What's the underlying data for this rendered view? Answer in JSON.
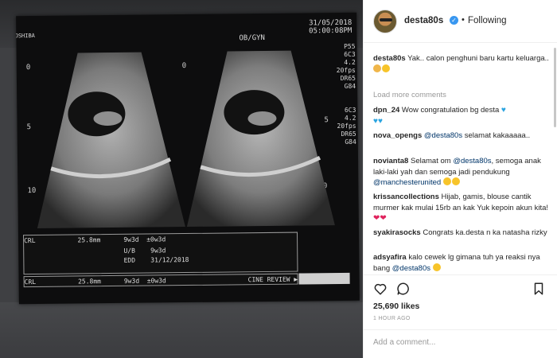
{
  "header": {
    "username": "desta80s",
    "verified_icon": "verified-badge-icon",
    "separator": "•",
    "follow_status": "Following"
  },
  "ultrasound": {
    "date": "31/05/2018",
    "time": "05:00:08PM",
    "mode": "OB/GYN",
    "brand": "TOSHIBA",
    "params_top": "P55\n6C3\n4.2\n20fps\nDR65\nG84",
    "params_mid": "6C3\n4.2\n20fps\nDR65\nG84",
    "scale_0": "0",
    "scale_5": "5",
    "scale_10": "10",
    "row1": "CRL           25.8mm      9w3d  ±0w3d",
    "row2": "                          U/B    9w3d",
    "row3": "                          EDD    31/12/2018",
    "row4": "CRL           25.8mm      9w3d  ±0w3d",
    "cine": "CINE REVIEW ▶"
  },
  "comments": {
    "caption": {
      "user": "desta80s",
      "text": "Yak.. calon penghuni baru kartu keluarga.."
    },
    "load_more": "Load more comments",
    "list": [
      {
        "user": "dpn_24",
        "text": "Wow congratulation bg desta"
      },
      {
        "user": "nova_opengs",
        "mention": "@desta80s",
        "text": "selamat kakaaaaa.."
      },
      {
        "user": "novianta8",
        "text_a": "Selamat om",
        "mention": "@desta80s",
        "text_b": ", semoga anak laki-laki yah dan semoga jadi pendukung",
        "mention2": "@manchesterunited"
      },
      {
        "user": "krissancollections",
        "text": "Hijab, gamis, blouse cantik murmer kak mulai 15rb an kak Yuk kepoin akun kita!"
      },
      {
        "user": "syakirasocks",
        "text": "Congrats ka.desta n ka natasha rizky"
      },
      {
        "user": "adsyafira",
        "text": "kalo cewek lg gimana tuh ya reaksi nya bang",
        "mention": "@desta80s"
      }
    ]
  },
  "actions": {
    "like_icon": "heart-icon",
    "comment_icon": "comment-icon",
    "save_icon": "bookmark-icon",
    "likes": "25,690 likes",
    "timestamp": "1 HOUR AGO",
    "add_comment_placeholder": "Add a comment..."
  }
}
